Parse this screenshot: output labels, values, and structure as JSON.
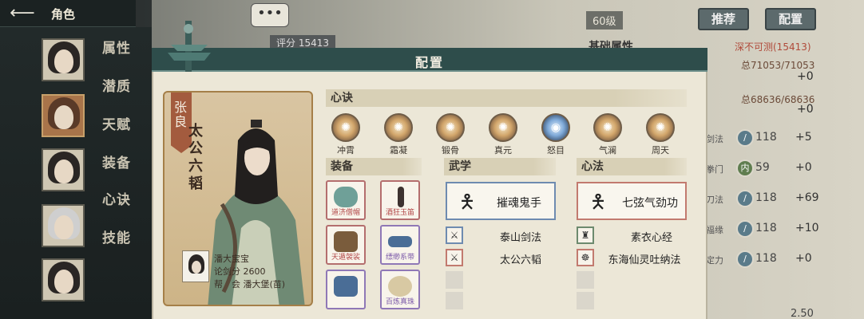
{
  "header": {
    "back_icon": "arrow-left-icon",
    "title": "角色"
  },
  "sidebar": {
    "items": [
      {
        "label": "属性"
      },
      {
        "label": "潜质"
      },
      {
        "label": "天赋"
      },
      {
        "label": "装备"
      },
      {
        "label": "心诀"
      },
      {
        "label": "技能"
      }
    ]
  },
  "background_panel": {
    "chat_bubble": "•••",
    "level": "60级",
    "buttons": {
      "recommend": "推荐",
      "config": "配置"
    },
    "score_label": "评分",
    "score_value": "15413",
    "attr_header": "基础属性",
    "rank_text": "深不可测(15413)",
    "hp_text": "总71053/71053",
    "hp_plus": "+0",
    "mp_text": "总68636/68636",
    "mp_plus": "+0",
    "stats": [
      {
        "label": "剑法",
        "value": "118",
        "bonus": "+5"
      },
      {
        "label": "拳门",
        "value": "59",
        "bonus": "+0"
      },
      {
        "label": "刀法",
        "value": "118",
        "bonus": "+69"
      },
      {
        "label": "福缘",
        "value": "118",
        "bonus": "+10"
      },
      {
        "label": "定力",
        "value": "118",
        "bonus": "+0"
      }
    ],
    "bottom_value": "2.50"
  },
  "modal": {
    "title": "配置",
    "character": {
      "name": "张良",
      "alias": "太公六韬",
      "player_name": "潘大宝宝",
      "sword_score": "论剑分 2600",
      "guild": "帮　会 潘大堡(苗)"
    },
    "xinjue": {
      "header": "心诀",
      "skills": [
        {
          "label": "冲霄",
          "icon": "chongxiao-icon"
        },
        {
          "label": "霜凝",
          "icon": "shuangning-icon"
        },
        {
          "label": "锻骨",
          "icon": "duangu-icon"
        },
        {
          "label": "真元",
          "icon": "zhenyuan-icon"
        },
        {
          "label": "怒目",
          "icon": "numu-icon",
          "color": "#7ea9d8"
        },
        {
          "label": "气澜",
          "icon": "qilan-icon"
        },
        {
          "label": "周天",
          "icon": "zhoutian-icon"
        }
      ]
    },
    "equipment": {
      "header": "装备",
      "items": [
        {
          "label": "道济僧帽",
          "rarity": "red"
        },
        {
          "label": "酒狂玉笛",
          "rarity": "red"
        },
        {
          "label": "天遁袈裟",
          "rarity": "red"
        },
        {
          "label": "缥缈系带",
          "rarity": "purple"
        },
        {
          "label": "",
          "rarity": "purple"
        },
        {
          "label": "百炼真珠",
          "rarity": "purple"
        }
      ]
    },
    "wuxue": {
      "header": "武学",
      "main": "摧魂鬼手",
      "list": [
        "泰山剑法",
        "太公六韬"
      ]
    },
    "xinfa": {
      "header": "心法",
      "main": "七弦气劲功",
      "list": [
        "素衣心经",
        "东海仙灵吐纳法"
      ]
    }
  }
}
